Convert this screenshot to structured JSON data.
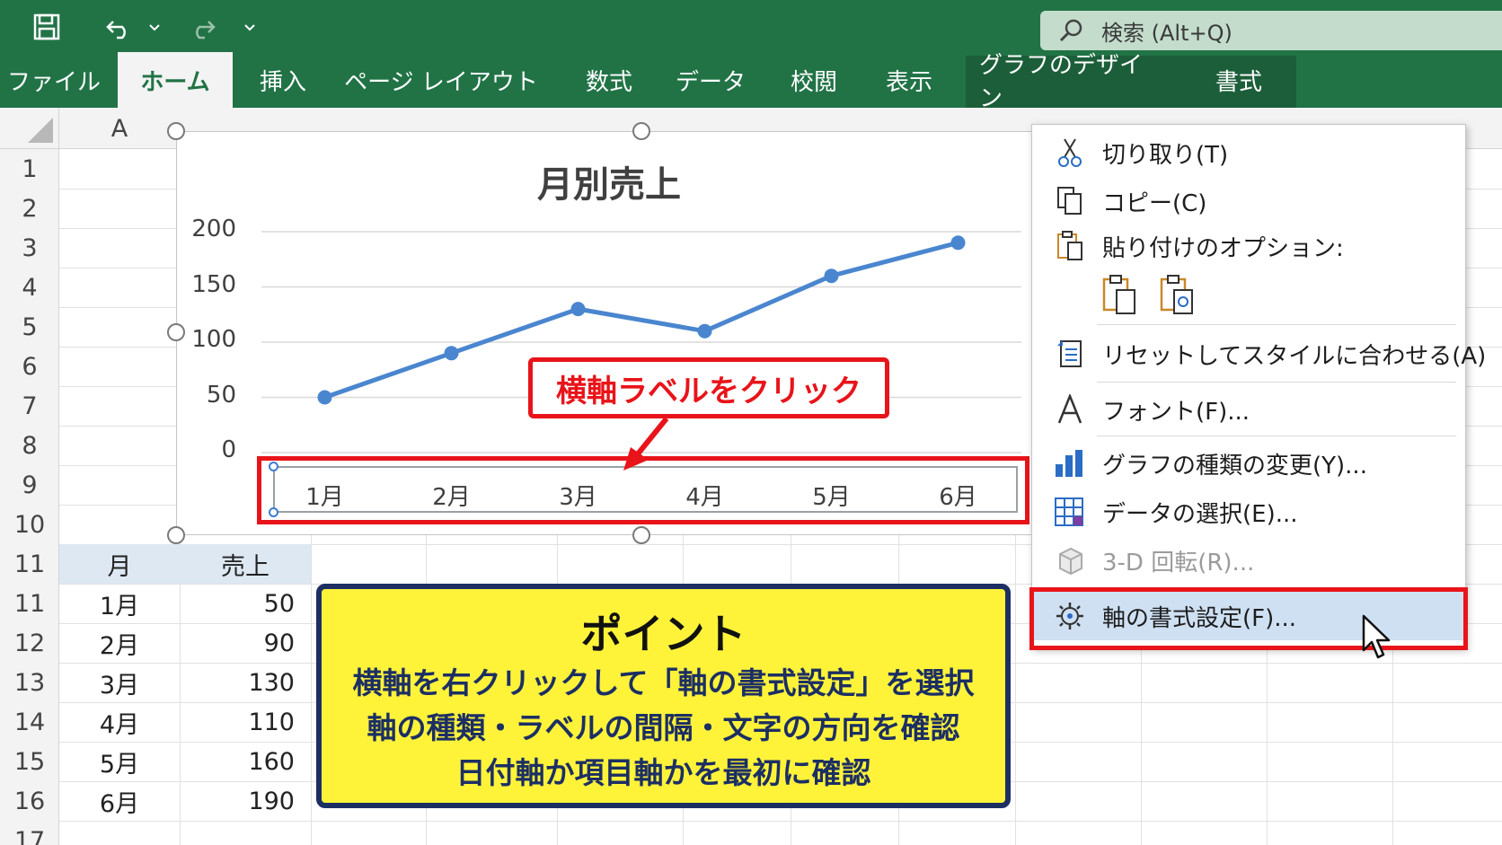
{
  "titlebar": {
    "search_placeholder": "検索 (Alt+Q)",
    "bg_color": "#217346"
  },
  "qat": {
    "icons": [
      "save-icon",
      "undo-icon",
      "dropdown-icon",
      "redo-icon",
      "customize-icon"
    ]
  },
  "ribbon": {
    "tabs": [
      "ファイル",
      "ホーム",
      "挿入",
      "ページ レイアウト",
      "数式",
      "データ",
      "校閲",
      "表示",
      "グラフのデザイン",
      "書式"
    ],
    "active_tab": "ホーム"
  },
  "sheet": {
    "col_headers": [
      "A"
    ],
    "row_headers": [
      "1",
      "2",
      "3",
      "4",
      "5",
      "6",
      "7",
      "8",
      "9",
      "10",
      "11",
      "11",
      "12",
      "13",
      "14",
      "15",
      "16",
      "17"
    ],
    "table": {
      "headers": [
        "月",
        "売上"
      ],
      "rows": [
        [
          "1月",
          "50"
        ],
        [
          "2月",
          "90"
        ],
        [
          "3月",
          "130"
        ],
        [
          "4月",
          "110"
        ],
        [
          "5月",
          "160"
        ],
        [
          "6月",
          "190"
        ]
      ]
    }
  },
  "chart_data": {
    "type": "line",
    "title": "月別売上",
    "categories": [
      "1月",
      "2月",
      "3月",
      "4月",
      "5月",
      "6月"
    ],
    "series": [
      {
        "values": [
          50,
          90,
          130,
          110,
          160,
          190
        ]
      }
    ],
    "y_ticks": [
      "200",
      "150",
      "100",
      "50",
      "0"
    ],
    "ylim": [
      0,
      200
    ],
    "grid": true,
    "line_color": "#4a86cf"
  },
  "annotation": {
    "callout": "横軸ラベルをクリック",
    "highlight_color": "#e8141a"
  },
  "point_box": {
    "title": "ポイント",
    "lines": [
      "横軸を右クリックして「軸の書式設定」を選択",
      "軸の種類・ラベルの間隔・文字の方向を確認",
      "日付軸か項目軸かを最初に確認"
    ]
  },
  "context_menu": {
    "items": [
      {
        "label": "切り取り(T)",
        "icon": "scissors-icon"
      },
      {
        "label": "コピー(C)",
        "icon": "copy-icon"
      },
      {
        "label": "貼り付けのオプション:",
        "icon": "paste-icon"
      },
      {
        "label": "リセットしてスタイルに合わせる(A)",
        "icon": "reset-style-icon"
      },
      {
        "label": "フォント(F)...",
        "icon": "font-icon"
      },
      {
        "label": "グラフの種類の変更(Y)...",
        "icon": "chart-type-icon"
      },
      {
        "label": "データの選択(E)...",
        "icon": "select-data-icon"
      },
      {
        "label": "3-D 回転(R)...",
        "icon": "3d-rotation-icon",
        "disabled": true
      },
      {
        "label": "軸の書式設定(F)...",
        "icon": "format-axis-icon",
        "highlighted": true
      }
    ],
    "paste_option_icons": [
      "paste-keep-format-icon",
      "paste-picture-icon"
    ]
  }
}
